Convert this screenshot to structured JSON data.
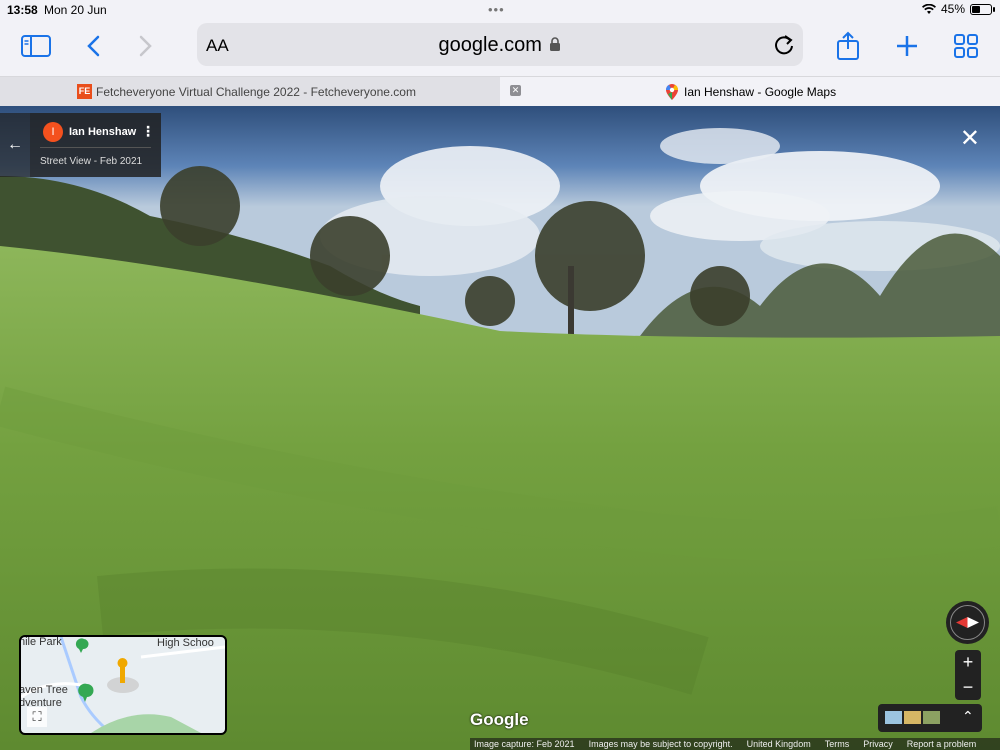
{
  "status_bar": {
    "time": "13:58",
    "date": "Mon 20 Jun",
    "battery": "45%",
    "battery_level": 0.45,
    "icons": [
      "wifi-icon",
      "battery-icon"
    ]
  },
  "toolbar": {
    "text_size_label": "AA",
    "url": "google.com",
    "icons": [
      "sidebar-icon",
      "back-icon",
      "forward-icon",
      "lock-icon",
      "reload-icon",
      "share-icon",
      "new-tab-icon",
      "tabs-overview-icon"
    ]
  },
  "tabs": [
    {
      "favicon_text": "FE",
      "title": "Fetcheveryone Virtual Challenge 2022 - Fetcheveryone.com",
      "active": false
    },
    {
      "favicon": "google-maps-icon",
      "title": "Ian Henshaw - Google Maps",
      "active": true
    }
  ],
  "streetview": {
    "contributor_initial": "I",
    "contributor_name": "Ian Henshaw",
    "capture_info": "Street View - Feb 2021",
    "accent": "#f4511e"
  },
  "minimap": {
    "labels": [
      "nile Park",
      "High Schoo",
      "aven Tree",
      "dventure"
    ]
  },
  "controls": {
    "zoom_in": "+",
    "zoom_out": "−",
    "expand_layers": "⌃"
  },
  "footer": {
    "logo": "Google",
    "links": [
      "Image capture: Feb 2021",
      "Images may be subject to copyright.",
      "United Kingdom",
      "Terms",
      "Privacy",
      "Report a problem"
    ]
  }
}
